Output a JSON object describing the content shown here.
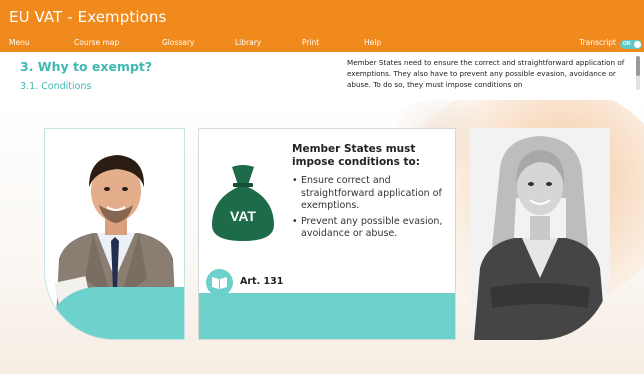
{
  "header": {
    "title": "EU VAT - Exemptions",
    "menu": [
      "Menu",
      "Course map",
      "Glossary",
      "Library",
      "Print",
      "Help"
    ],
    "transcript_label": "Transcript",
    "toggle_text": "ON"
  },
  "section": {
    "title": "3. Why to exempt?",
    "subtitle": "3.1. Conditions"
  },
  "transcript_text": "Member States need to ensure the correct and straightforward application of exemptions. They also have to prevent any possible evasion, avoidance or abuse. To do so, they must impose conditions on",
  "card": {
    "heading": "Member States must impose conditions to:",
    "bullets": [
      "Ensure correct and straightforward application of exemptions.",
      "Prevent any possible evasion, avoidance or abuse."
    ],
    "bag_label": "VAT",
    "article": "Art. 131",
    "article_icon": "book-icon"
  },
  "colors": {
    "header": "#f08a1c",
    "accent": "#3fb8b2",
    "band": "#6dd1cb"
  }
}
